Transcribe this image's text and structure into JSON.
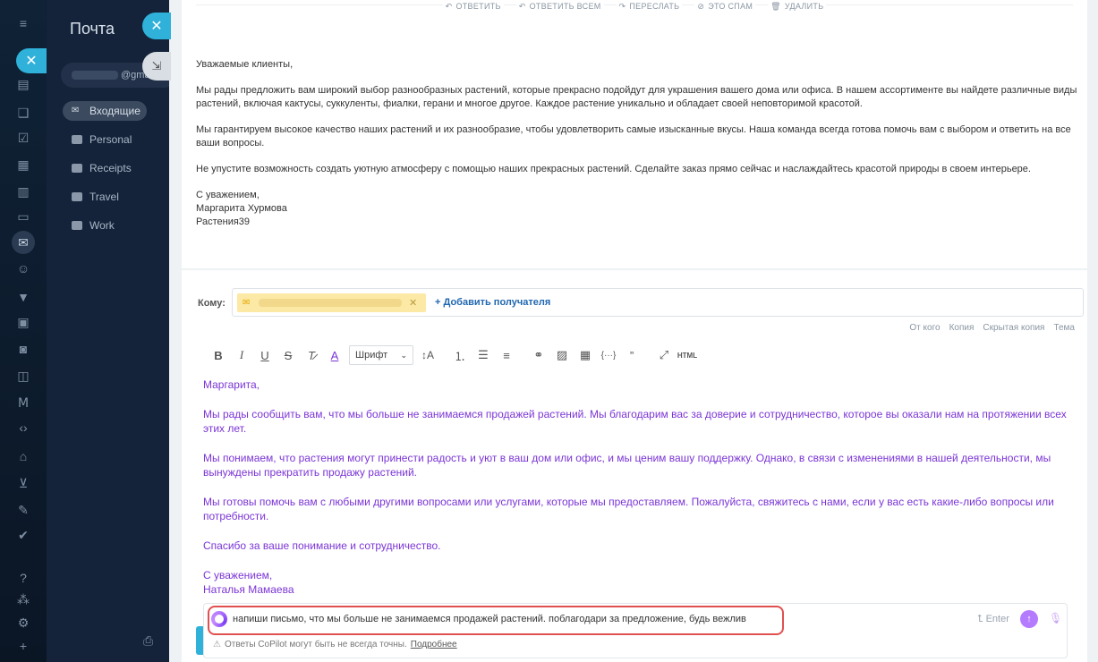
{
  "sidebar": {
    "title": "Почта",
    "account_suffix": "@gma",
    "folders": [
      {
        "label": "Входящие"
      },
      {
        "label": "Personal"
      },
      {
        "label": "Receipts"
      },
      {
        "label": "Travel"
      },
      {
        "label": "Work"
      }
    ]
  },
  "letter": {
    "actions": {
      "reply": "ОТВЕТИТЬ",
      "reply_all": "ОТВЕТИТЬ ВСЕМ",
      "forward": "ПЕРЕСЛАТЬ",
      "spam": "ЭТО СПАМ",
      "delete": "УДАЛИТЬ"
    },
    "paragraphs": [
      "Уважаемые клиенты,",
      "Мы рады предложить вам широкий выбор разнообразных растений, которые прекрасно подойдут для украшения вашего дома или офиса. В нашем ассортименте вы найдете различные виды растений, включая кактусы, суккуленты, фиалки, герани и многое другое. Каждое растение уникально и обладает своей неповторимой красотой.",
      "Мы гарантируем высокое качество наших растений и их разнообразие, чтобы удовлетворить самые изысканные вкусы. Наша команда всегда готова помочь вам с выбором и ответить на все ваши вопросы.",
      "Не упустите возможность создать уютную атмосферу с помощью наших прекрасных растений. Сделайте заказ прямо сейчас и наслаждайтесь красотой природы в своем интерьере."
    ],
    "signature": {
      "closing": "С уважением,",
      "name": "Маргарита Хурмова",
      "company": "Растения39"
    }
  },
  "composer": {
    "to_label": "Кому:",
    "add_recipient": "+ Добавить получателя",
    "cc_options": [
      "От кого",
      "Копия",
      "Скрытая копия",
      "Тема"
    ],
    "font_select": "Шрифт",
    "reply_paragraphs": [
      "Маргарита,",
      "Мы рады сообщить вам, что мы больше не занимаемся продажей растений. Мы благодарим вас за доверие и сотрудничество, которое вы оказали нам на протяжении всех этих лет.",
      "Мы понимаем, что растения могут принести радость и уют в ваш дом или офис, и мы ценим вашу поддержку. Однако, в связи с изменениями в нашей деятельности, мы вынуждены прекратить продажу растений.",
      "Мы готовы помочь вам с любыми другими вопросами или услугами, которые мы предоставляем. Пожалуйста, свяжитесь с нами, если у вас есть какие-либо вопросы или потребности.",
      "Спасибо за ваше понимание и сотрудничество."
    ],
    "reply_signature": {
      "closing": "С уважением,",
      "name": "Наталья Мамаева"
    }
  },
  "copilot": {
    "prompt": "напиши письмо, что мы больше не занимаемся продажей растений. поблагодари за предложение, будь вежлив",
    "enter_hint": "Enter",
    "warning": "Ответы CoPilot могут быть не всегда точны.",
    "more_link": "Подробнее"
  },
  "colors": {
    "accent": "#2fb1d9",
    "copilot_purple": "#7b35d6",
    "highlight_red": "#e05050",
    "chip_yellow": "#fbe9a5"
  }
}
